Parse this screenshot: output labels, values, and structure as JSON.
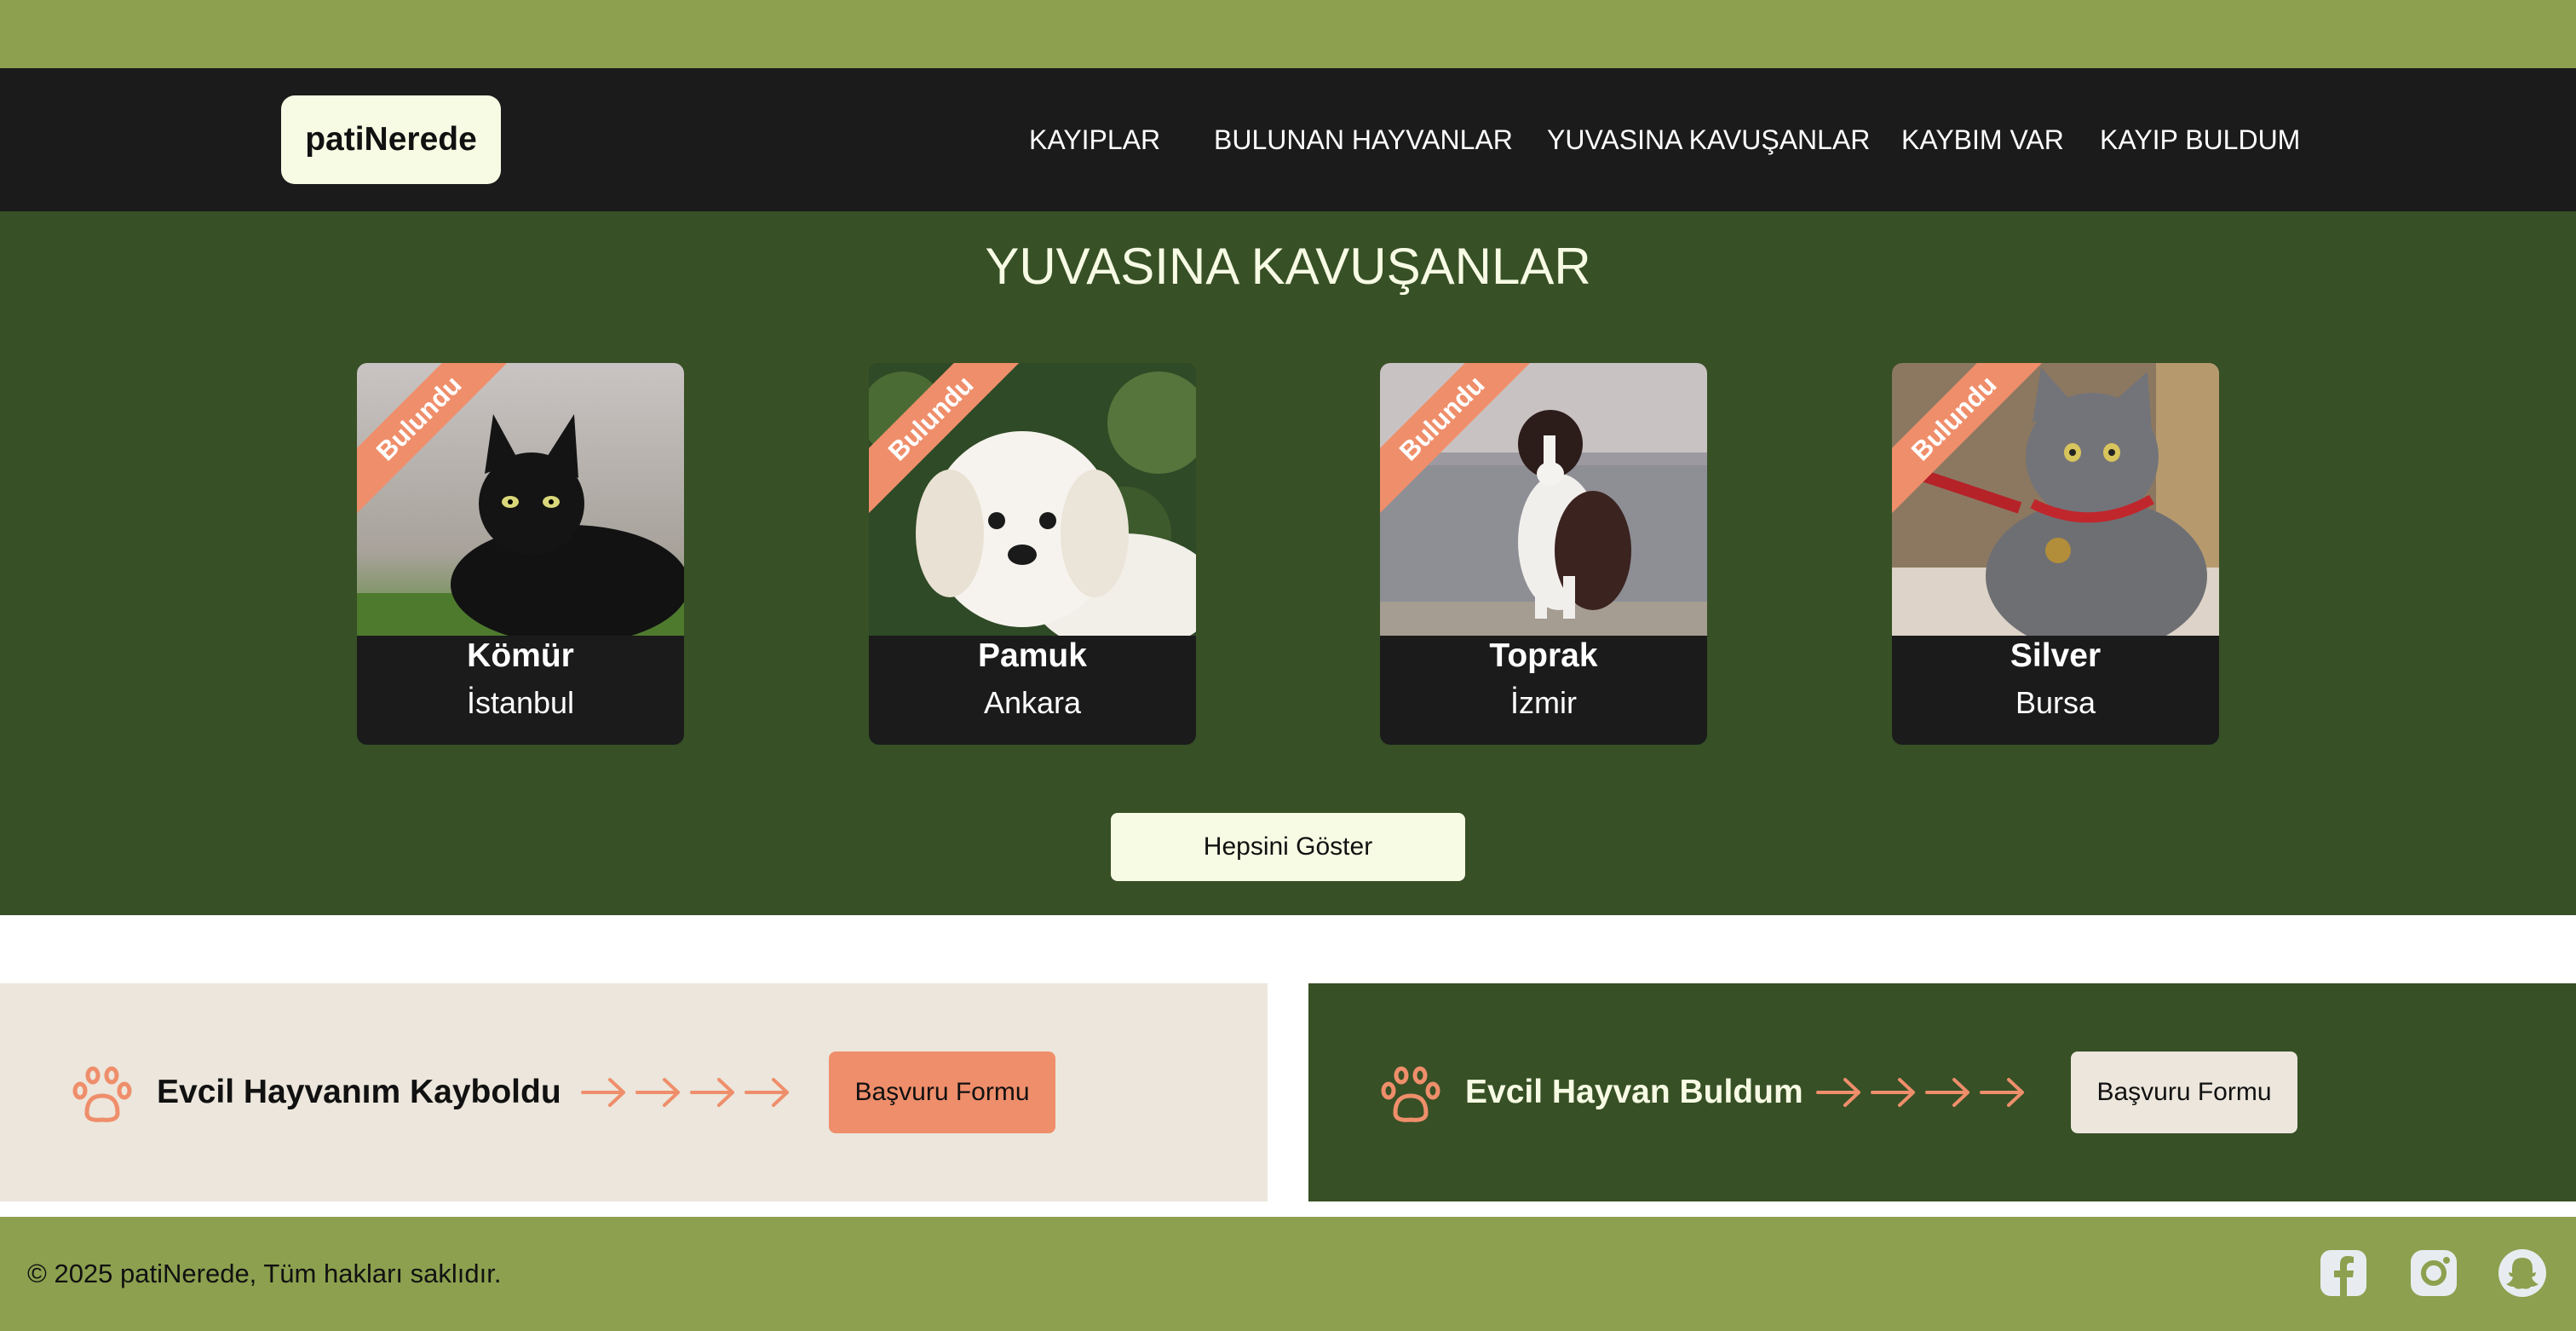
{
  "brand": {
    "logo": "patiNerede"
  },
  "nav": {
    "items": [
      {
        "label": "KAYIPLAR"
      },
      {
        "label": "BULUNAN HAYVANLAR"
      },
      {
        "label": "YUVASINA KAVUŞANLAR"
      },
      {
        "label": "KAYBIM VAR"
      },
      {
        "label": "KAYIP BULDUM"
      }
    ]
  },
  "hero": {
    "title": "YUVASINA KAVUŞANLAR",
    "cards": [
      {
        "badge": "Bulundu",
        "name": "Kömür",
        "city": "İstanbul",
        "photo": "black-cat-photo"
      },
      {
        "badge": "Bulundu",
        "name": "Pamuk",
        "city": "Ankara",
        "photo": "white-puppy-photo"
      },
      {
        "badge": "Bulundu",
        "name": "Toprak",
        "city": "İzmir",
        "photo": "border-collie-photo"
      },
      {
        "badge": "Bulundu",
        "name": "Silver",
        "city": "Bursa",
        "photo": "grey-cat-photo"
      }
    ],
    "show_all_label": "Hepsini Göster"
  },
  "cta": {
    "lost": {
      "icon": "paw-icon",
      "title": "Evcil Hayvanım Kayboldu",
      "button": "Başvuru Formu"
    },
    "found": {
      "icon": "paw-icon",
      "title": "Evcil Hayvan Buldum",
      "button": "Başvuru Formu"
    }
  },
  "footer": {
    "copyright": "© 2025 patiNerede, Tüm hakları saklıdır.",
    "social": [
      "facebook-icon",
      "instagram-icon",
      "snapchat-icon"
    ]
  },
  "colors": {
    "olive": "#8ca04f",
    "dark": "#1b1b1b",
    "forest": "#375026",
    "cream": "#f7fbe4",
    "salmon": "#ef8e6b",
    "beige": "#ece6dc"
  }
}
